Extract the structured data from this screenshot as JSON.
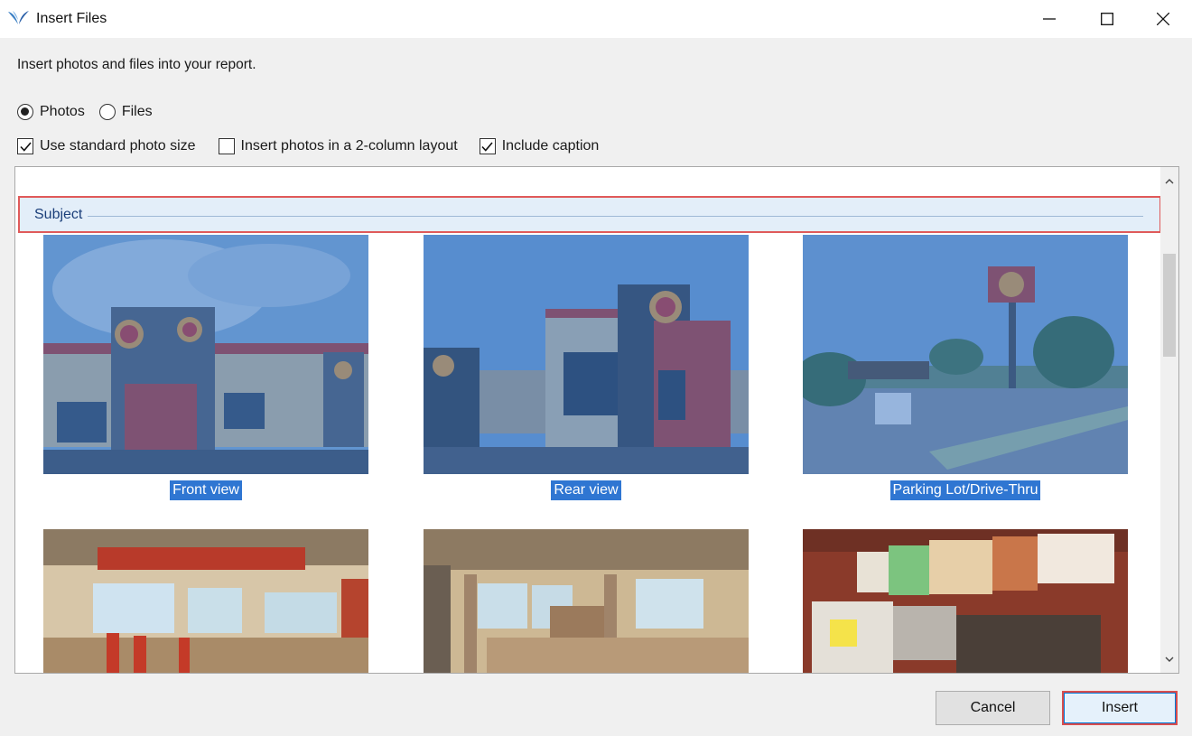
{
  "window": {
    "title": "Insert Files",
    "logo_icon": "app-wing-logo-icon",
    "minimize_icon": "minimize-icon",
    "maximize_icon": "maximize-icon",
    "close_icon": "close-icon"
  },
  "instruction": "Insert photos and files into your report.",
  "mode": {
    "options": [
      {
        "label": "Photos",
        "selected": true
      },
      {
        "label": "Files",
        "selected": false
      }
    ]
  },
  "settings": {
    "standard_size": {
      "label": "Use standard photo size",
      "checked": true
    },
    "two_column": {
      "label": "Insert photos in a 2-column layout",
      "checked": false
    },
    "include_caption": {
      "label": "Include caption",
      "checked": true
    }
  },
  "group": {
    "label": "Subject"
  },
  "photos": [
    {
      "caption": "Front view",
      "selected": true
    },
    {
      "caption": "Rear view",
      "selected": true
    },
    {
      "caption": "Parking Lot/Drive-Thru",
      "selected": true
    },
    {
      "caption": "",
      "selected": false
    },
    {
      "caption": "",
      "selected": false
    },
    {
      "caption": "",
      "selected": false
    }
  ],
  "buttons": {
    "cancel": "Cancel",
    "insert": "Insert"
  },
  "colors": {
    "selection": "#2f76d2",
    "highlight_border": "#e05a5a",
    "group_background": "#e3eef9"
  }
}
